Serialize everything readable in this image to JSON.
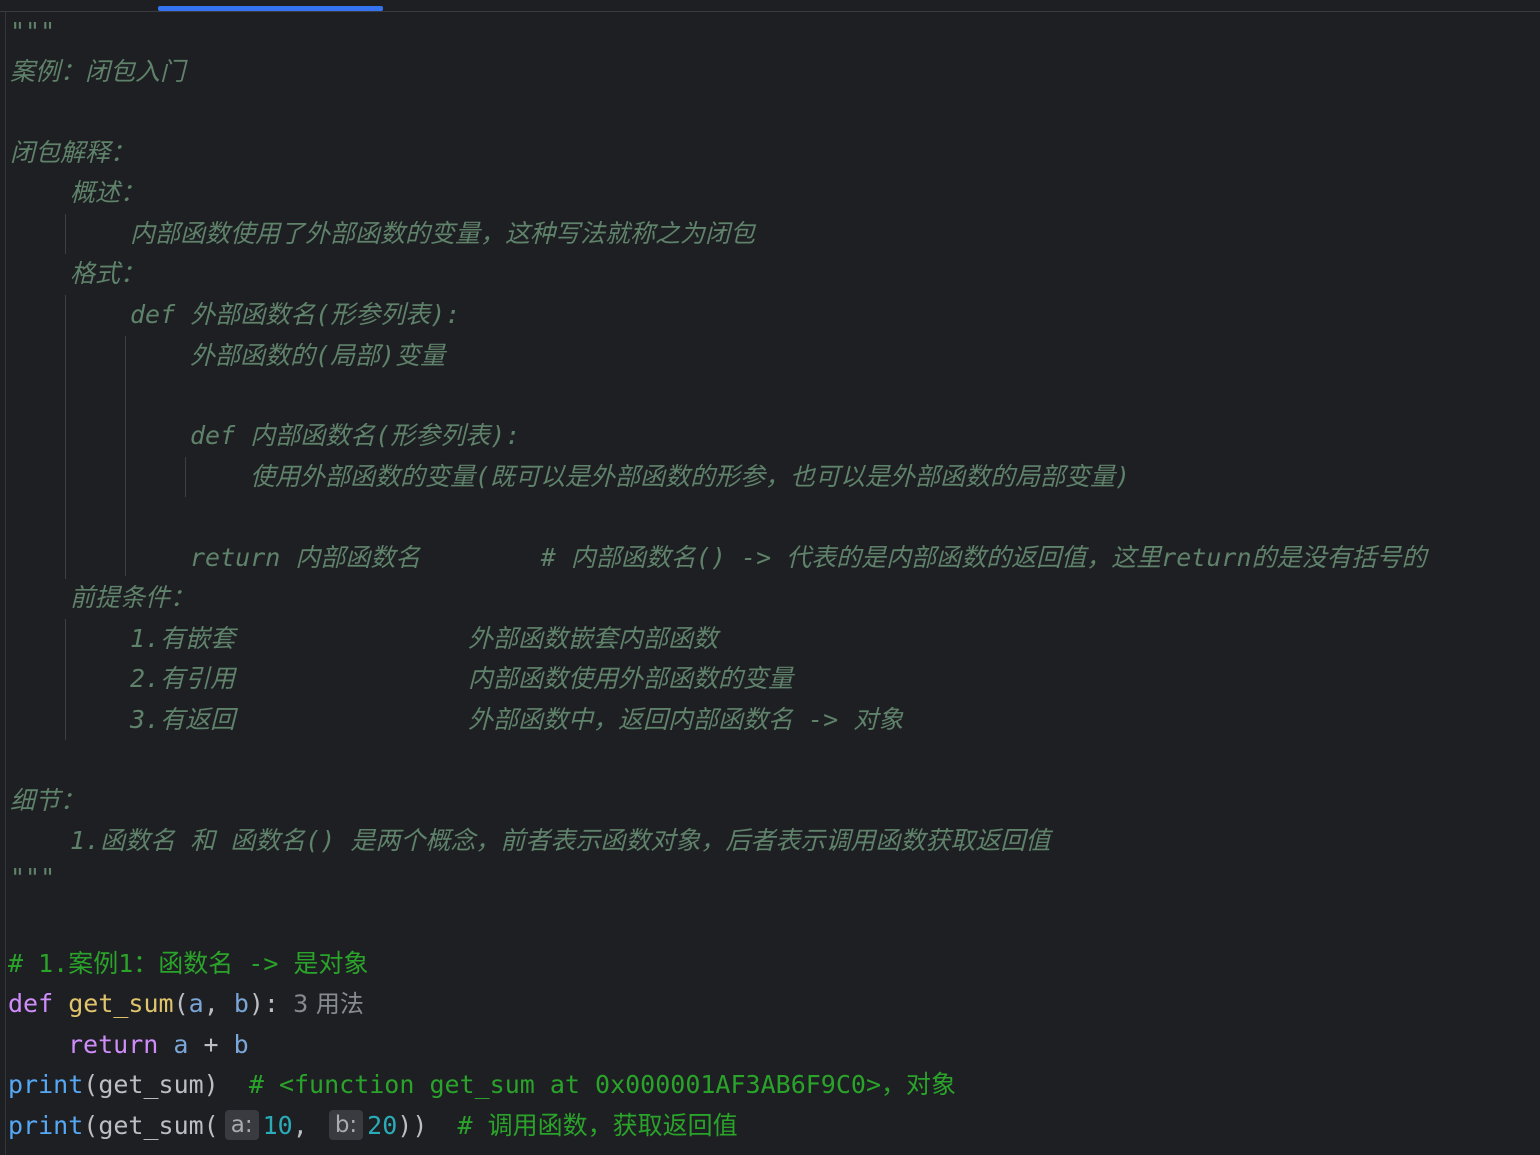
{
  "editor": {
    "docstring": {
      "open_quotes": "\"\"\"",
      "title": "案例：闭包入门",
      "explain_heading": "闭包解释：",
      "overview_heading": "概述：",
      "overview_text": "内部函数使用了外部函数的变量，这种写法就称之为闭包",
      "format_heading": "格式：",
      "format_def_outer": "def 外部函数名(形参列表):",
      "format_outer_var": "外部函数的(局部)变量",
      "format_def_inner": "def 内部函数名(形参列表):",
      "format_inner_body": "使用外部函数的变量(既可以是外部函数的形参，也可以是外部函数的局部变量)",
      "format_return": "return 内部函数名        # 内部函数名() -> 代表的是内部函数的返回值，这里return的是没有括号的",
      "prereq_heading": "前提条件：",
      "prereq_items": [
        {
          "label": "1.有嵌套",
          "desc": "外部函数嵌套内部函数"
        },
        {
          "label": "2.有引用",
          "desc": "内部函数使用外部函数的变量"
        },
        {
          "label": "3.有返回",
          "desc": "外部函数中，返回内部函数名 -> 对象"
        }
      ],
      "details_heading": "细节：",
      "details_item": "1.函数名 和 函数名() 是两个概念，前者表示函数对象，后者表示调用函数获取返回值",
      "close_quotes": "\"\"\""
    },
    "code": {
      "comment_case": "# 1.案例1：函数名 -> 是对象",
      "def_keyword": "def",
      "def_name": "get_sum",
      "paren_open": "(",
      "param_a": "a",
      "comma_space": ", ",
      "param_b": "b",
      "def_close": "):",
      "usage_hint": "3 用法",
      "return_keyword": "return",
      "return_expr_a": "a",
      "return_op": " + ",
      "return_expr_b": "b",
      "print1_fn": "print",
      "print1_args": "(get_sum)",
      "print1_comment": "# <function get_sum at 0x000001AF3AB6F9C0>，对象",
      "print2_fn": "print",
      "print2_open": "(get_sum(",
      "print2_hint_a": "a:",
      "print2_val_a": "10",
      "print2_comma": ",",
      "print2_hint_b": "b:",
      "print2_val_b": "20",
      "print2_close": "))",
      "print2_comment": "# 调用函数，获取返回值"
    }
  },
  "colors": {
    "background": "#1e1f22",
    "docstring": "#5f826b",
    "comment": "#2aa32a",
    "keyword": "#cf8dfb",
    "builtin_function": "#56a8f5",
    "function_name": "#e0c46c",
    "number": "#2aacb8",
    "tab_indicator": "#3574f0"
  }
}
